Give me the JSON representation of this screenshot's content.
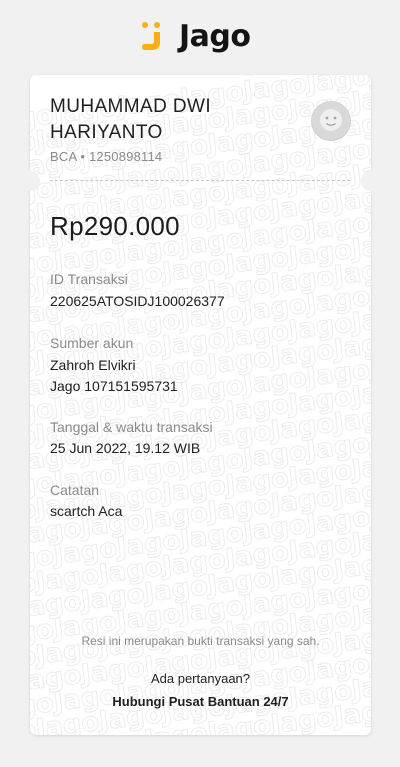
{
  "brand": {
    "name": "Jago",
    "logo_icon": "jago-logo-icon",
    "accent_color": "#F6B010"
  },
  "watermark_text": "Jago",
  "recipient": {
    "name": "MUHAMMAD DWI HARIYANTO",
    "bank": "BCA • 1250898114",
    "avatar_icon": "avatar-icon"
  },
  "amount": "Rp290.000",
  "fields": {
    "transaction_id": {
      "label": "ID Transaksi",
      "value": "220625ATOSIDJ100026377"
    },
    "source_account": {
      "label": "Sumber akun",
      "name": "Zahroh Elvikri",
      "account": "Jago 107151595731"
    },
    "datetime": {
      "label": "Tanggal & waktu transaksi",
      "value": "25 Jun 2022, 19.12 WIB"
    },
    "note": {
      "label": "Catatan",
      "value": "scartch Aca"
    }
  },
  "footer": {
    "receipt_note": "Resi ini merupakan bukti transaksi yang sah.",
    "question": "Ada pertanyaan?",
    "help_link": "Hubungi Pusat Bantuan 24/7"
  }
}
